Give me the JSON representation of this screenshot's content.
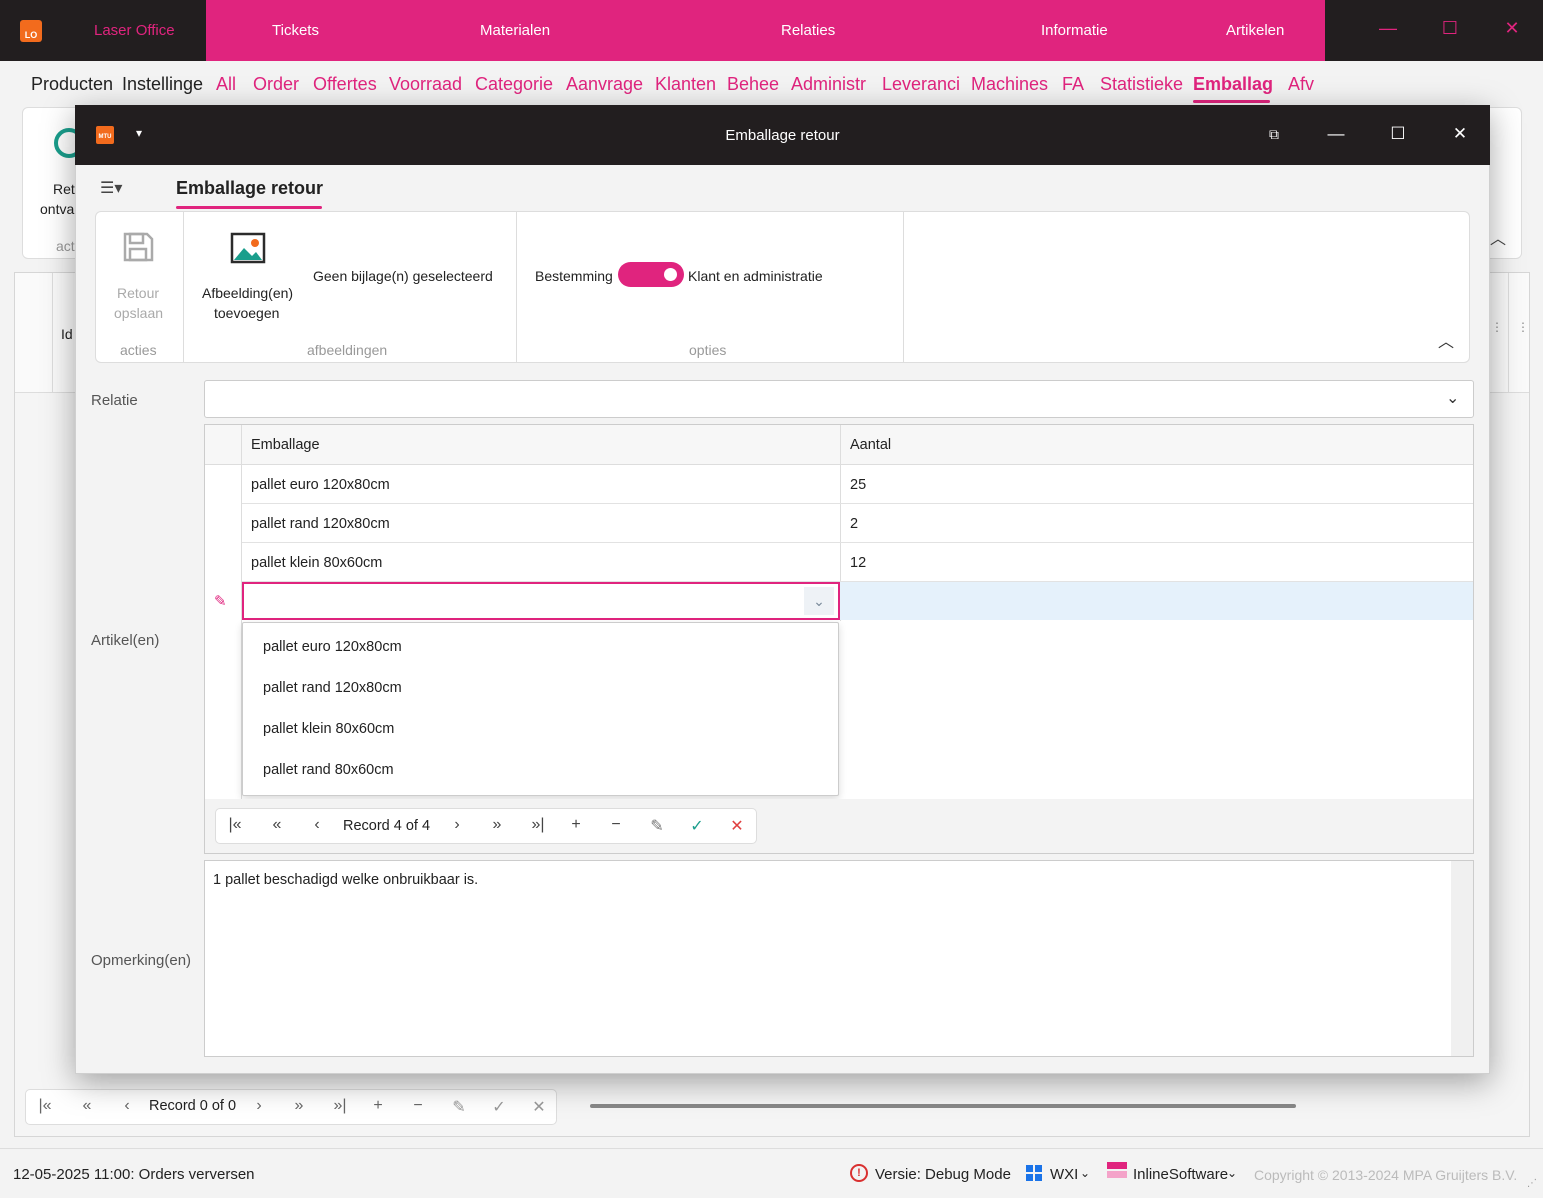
{
  "app": {
    "logo_text": "LO",
    "name": "Laser Office",
    "top_nav": [
      "Tickets",
      "Materialen",
      "Relaties",
      "Informatie",
      "Artikelen"
    ]
  },
  "tabs": [
    "Producten",
    "Instellinge",
    "All",
    "Order",
    "Offertes",
    "Voorraad",
    "Categorie",
    "Aanvrage",
    "Klanten",
    "Behee",
    "Administr",
    "Leveranci",
    "Machines",
    "FA",
    "Statistieke",
    "Emballag",
    "Afv"
  ],
  "background": {
    "ribbon_partial_1": "Ret",
    "ribbon_partial_2": "ontva",
    "ribbon_partial_3": "act",
    "grid_partial_header": "Id",
    "nav_record": "Record 0 of 0"
  },
  "status": {
    "message": "12-05-2025 11:00: Orders verversen",
    "version": "Versie: Debug Mode",
    "theme": "WXI",
    "company": "InlineSoftware",
    "copyright": "Copyright © 2013-2024 MPA Gruijters B.V."
  },
  "modal": {
    "logo_text": "MTU",
    "title": "Emballage retour",
    "tab": "Emballage retour",
    "ribbon": {
      "save_label_1": "Retour",
      "save_label_2": "opslaan",
      "group_acties": "acties",
      "add_image_label_1": "Afbeelding(en)",
      "add_image_label_2": "toevoegen",
      "no_attachments": "Geen bijlage(n) geselecteerd",
      "group_afbeeldingen": "afbeeldingen",
      "destination_label": "Bestemming",
      "destination_value": "Klant en administratie",
      "group_opties": "opties"
    },
    "fields": {
      "relatie_label": "Relatie",
      "relatie_value": "",
      "artikelen_label": "Artikel(en)",
      "opmerking_label": "Opmerking(en)",
      "opmerking_value": "1 pallet beschadigd welke onbruikbaar is."
    },
    "grid": {
      "columns": [
        "Emballage",
        "Aantal"
      ],
      "rows": [
        {
          "emballage": "pallet euro 120x80cm",
          "aantal": "25"
        },
        {
          "emballage": "pallet rand 120x80cm",
          "aantal": "2"
        },
        {
          "emballage": "pallet klein 80x60cm",
          "aantal": "12"
        }
      ],
      "dropdown_options": [
        "pallet euro 120x80cm",
        "pallet rand 120x80cm",
        "pallet klein 80x60cm",
        "pallet rand 80x60cm"
      ],
      "nav_record": "Record 4 of 4"
    }
  },
  "colors": {
    "accent": "#e0247e",
    "titlebar": "#221e1f",
    "logo": "#f26b1d"
  }
}
